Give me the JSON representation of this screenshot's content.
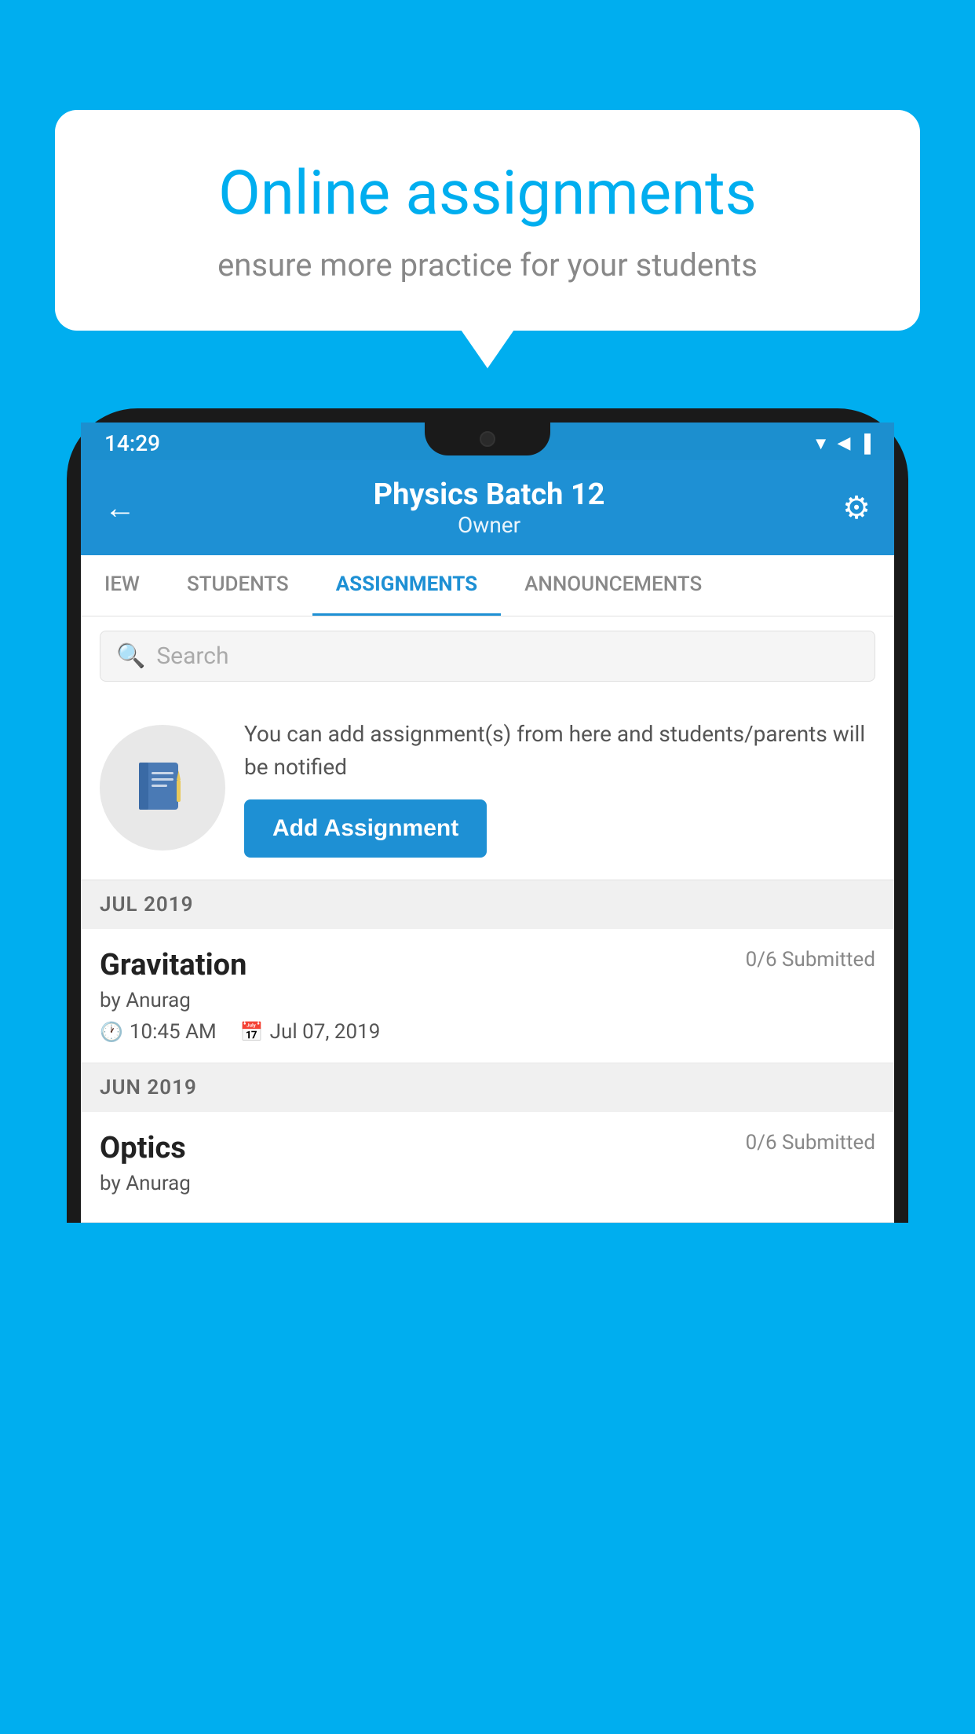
{
  "background_color": "#00AEEF",
  "speech_bubble": {
    "title": "Online assignments",
    "subtitle": "ensure more practice for your students"
  },
  "phone": {
    "status_bar": {
      "time": "14:29"
    },
    "header": {
      "title": "Physics Batch 12",
      "subtitle": "Owner",
      "back_label": "←",
      "gear_label": "⚙"
    },
    "tabs": [
      {
        "id": "iew",
        "label": "IEW",
        "active": false
      },
      {
        "id": "students",
        "label": "STUDENTS",
        "active": false
      },
      {
        "id": "assignments",
        "label": "ASSIGNMENTS",
        "active": true
      },
      {
        "id": "announcements",
        "label": "ANNOUNCEMENTS",
        "active": false
      }
    ],
    "search": {
      "placeholder": "Search",
      "search_icon": "🔍"
    },
    "promo": {
      "icon": "📓",
      "description": "You can add assignment(s) from here and students/parents will be notified",
      "button_label": "Add Assignment"
    },
    "sections": [
      {
        "label": "JUL 2019",
        "assignments": [
          {
            "name": "Gravitation",
            "submitted": "0/6 Submitted",
            "by": "by Anurag",
            "time": "10:45 AM",
            "date": "Jul 07, 2019"
          }
        ]
      },
      {
        "label": "JUN 2019",
        "assignments": [
          {
            "name": "Optics",
            "submitted": "0/6 Submitted",
            "by": "by Anurag",
            "time": "",
            "date": ""
          }
        ]
      }
    ]
  }
}
